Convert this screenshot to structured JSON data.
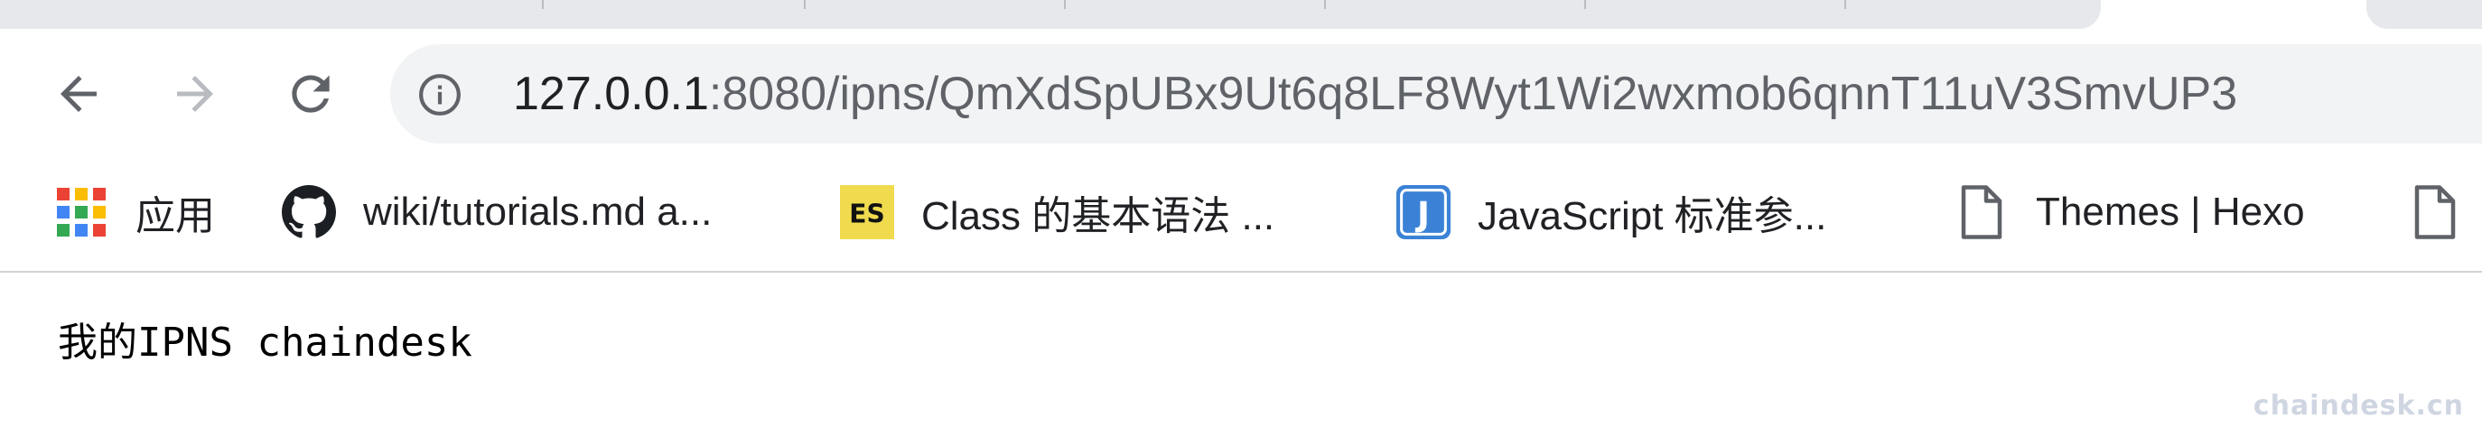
{
  "address_bar": {
    "url_host": "127.0.0.1",
    "url_rest": ":8080/ipns/QmXdSpUBx9Ut6q8LF8Wyt1Wi2wxmob6qnnT11uV3SmvUP3"
  },
  "nav": {
    "back_icon": "arrow-left-icon",
    "forward_icon": "arrow-right-icon",
    "reload_icon": "reload-icon",
    "info_icon": "info-icon"
  },
  "bookmarks": [
    {
      "label": "应用",
      "icon": "apps-grid-icon"
    },
    {
      "label": "wiki/tutorials.md a...",
      "icon": "github-icon"
    },
    {
      "label": "Class 的基本语法 ...",
      "icon": "es-badge-icon",
      "icon_text": "ES"
    },
    {
      "label": "JavaScript 标准参...",
      "icon": "j-badge-icon",
      "icon_text": "J"
    },
    {
      "label": "Themes | Hexo",
      "icon": "page-icon"
    }
  ],
  "page": {
    "text": "我的IPNS chaindesk"
  },
  "watermark": "chaindesk.cn",
  "colors": {
    "tabstrip": "#e6e8eb",
    "omnibox": "#f1f3f4",
    "es_badge": "#f0db4f",
    "j_badge": "#3b82d6"
  }
}
